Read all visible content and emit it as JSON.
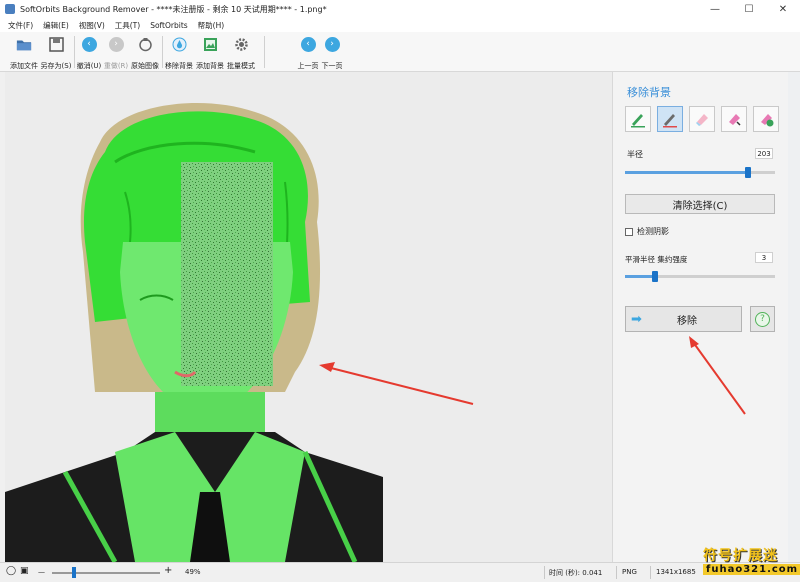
{
  "window": {
    "title": "SoftOrbits Background Remover - ****未注册版 - 剩余 10 天试用期**** - 1.png*",
    "minimize": "—",
    "maximize": "☐",
    "close": "✕"
  },
  "menu": [
    "文件(F)",
    "编辑(E)",
    "视图(V)",
    "工具(T)",
    "SoftOrbits",
    "帮助(H)"
  ],
  "toolbar": {
    "add_file": "添加文件",
    "save_as": "另存为(S)",
    "undo": "撤消(U)",
    "redo": "重做(R)",
    "original": "原始图像",
    "remove_bg": "移除背景",
    "add_bg": "添加背景",
    "batch": "批量模式",
    "prev": "上一页",
    "next": "下一页"
  },
  "panel": {
    "title": "移除背景",
    "radius_label": "半径",
    "radius_value": "203",
    "radius_fraction": 0.82,
    "clear_selection": "清除选择(C)",
    "detect_shadow": "检测阴影",
    "smooth_label": "平滑半径 集约强度",
    "smooth_value": "3",
    "smooth_fraction": 0.2,
    "remove_button": "移除",
    "help_symbol": "?",
    "arrow_symbol": "➡"
  },
  "statusbar": {
    "zoom_out": "—",
    "zoom_in": "+",
    "zoom_value": "49%",
    "zoom_fraction": 0.2,
    "time": "时间 (秒): 0.041",
    "format": "PNG",
    "dimensions": "1341x1685"
  },
  "watermark": {
    "line1": "符号扩展迷",
    "line2": "fuhao321.com"
  },
  "colors": {
    "accent": "#3a8fd8",
    "overlay_green": "#55e055",
    "arrow_red": "#e53a2f"
  }
}
